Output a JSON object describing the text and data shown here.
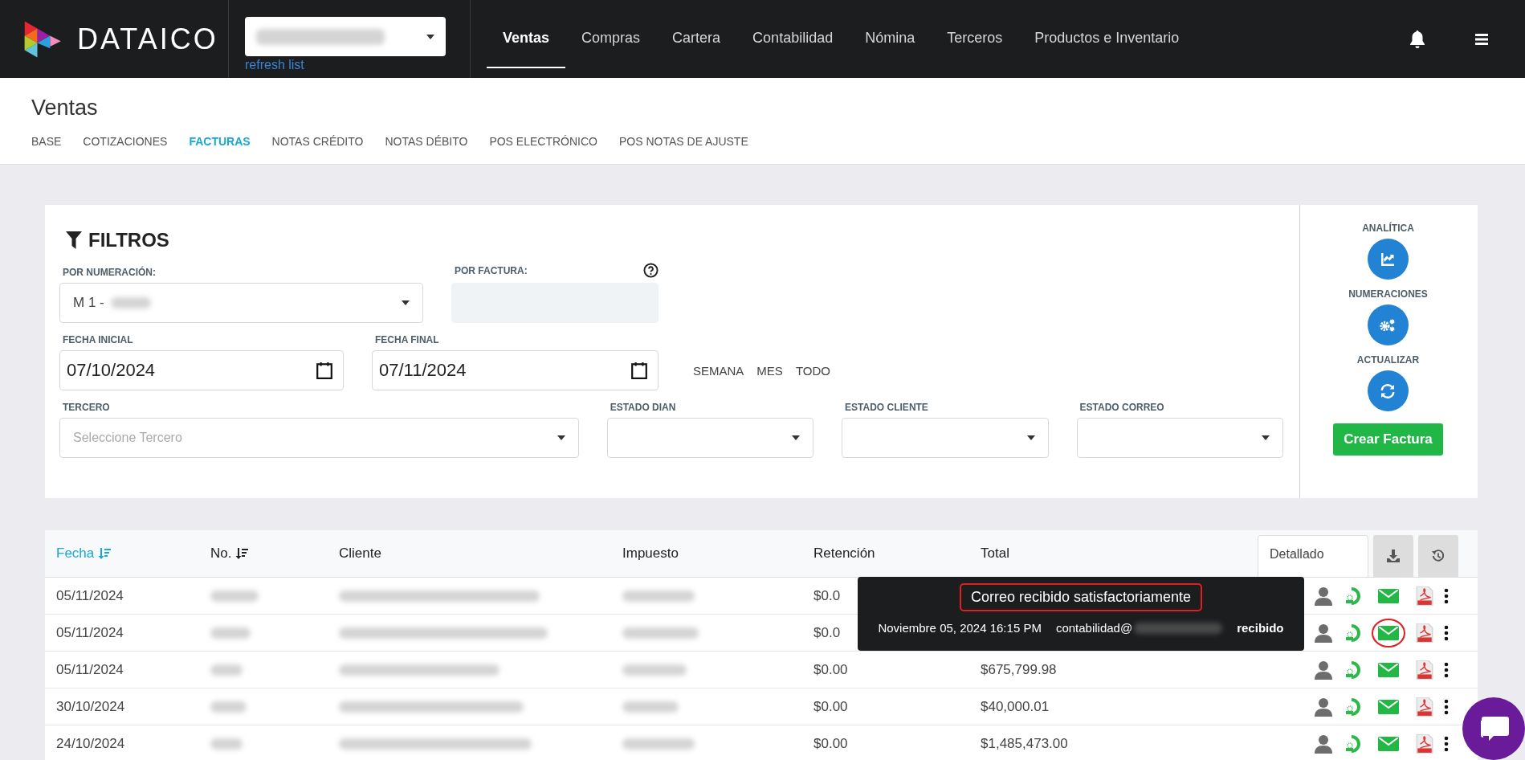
{
  "topbar": {
    "brand": "DATAICO",
    "refresh_link": "refresh list",
    "nav": [
      {
        "label": "Ventas",
        "selected": true
      },
      {
        "label": "Compras",
        "selected": false
      },
      {
        "label": "Cartera",
        "selected": false
      },
      {
        "label": "Contabilidad",
        "selected": false
      },
      {
        "label": "Nómina",
        "selected": false
      },
      {
        "label": "Terceros",
        "selected": false
      },
      {
        "label": "Productos e Inventario",
        "selected": false
      }
    ]
  },
  "page": {
    "title": "Ventas",
    "tabs": [
      {
        "label": "BASE",
        "selected": false
      },
      {
        "label": "COTIZACIONES",
        "selected": false
      },
      {
        "label": "FACTURAS",
        "selected": true
      },
      {
        "label": "NOTAS CRÉDITO",
        "selected": false
      },
      {
        "label": "NOTAS DÉBITO",
        "selected": false
      },
      {
        "label": "POS ELECTRÓNICO",
        "selected": false
      },
      {
        "label": "POS NOTAS DE AJUSTE",
        "selected": false
      }
    ]
  },
  "filters": {
    "title": "FILTROS",
    "numeracion": {
      "label": "POR NUMERACIÓN:",
      "value": "M 1 -"
    },
    "factura": {
      "label": "POR FACTURA:"
    },
    "fecha_inicial": {
      "label": "FECHA INICIAL",
      "value": "07/10/2024"
    },
    "fecha_final": {
      "label": "FECHA FINAL",
      "value": "07/11/2024"
    },
    "quick_ranges": [
      "SEMANA",
      "MES",
      "TODO"
    ],
    "tercero": {
      "label": "TERCERO",
      "placeholder": "Seleccione Tercero"
    },
    "estados": [
      {
        "label": "ESTADO DIAN"
      },
      {
        "label": "ESTADO CLIENTE"
      },
      {
        "label": "ESTADO CORREO"
      }
    ]
  },
  "actions": {
    "items": [
      {
        "label": "ANALÍTICA",
        "kind": "chart"
      },
      {
        "label": "NUMERACIONES",
        "kind": "gears"
      },
      {
        "label": "ACTUALIZAR",
        "kind": "refresh"
      }
    ],
    "create_button": "Crear Factura"
  },
  "table": {
    "columns": [
      {
        "label": "Fecha",
        "sortable": true,
        "selected": true
      },
      {
        "label": "No.",
        "sortable": true,
        "selected": false
      },
      {
        "label": "Cliente",
        "sortable": false,
        "selected": false
      },
      {
        "label": "Impuesto",
        "sortable": false,
        "selected": false
      },
      {
        "label": "Retención",
        "sortable": false,
        "selected": false
      },
      {
        "label": "Total",
        "sortable": false,
        "selected": false
      }
    ],
    "view_select": "Detallado",
    "rows": [
      {
        "fecha": "05/11/2024",
        "retencion": "$0.0",
        "highlighted": false
      },
      {
        "fecha": "05/11/2024",
        "retencion": "$0.0",
        "highlighted": true
      },
      {
        "fecha": "05/11/2024",
        "retencion": "$0.00",
        "total": "$675,799.98",
        "highlighted": false
      },
      {
        "fecha": "30/10/2024",
        "retencion": "$0.00",
        "total": "$40,000.01",
        "highlighted": false
      },
      {
        "fecha": "24/10/2024",
        "retencion": "$0.00",
        "total": "$1,485,473.00",
        "highlighted": false
      }
    ]
  },
  "tooltip": {
    "title": "Correo recibido satisfactoriamente",
    "title_highlighted": true,
    "date": "Noviembre 05, 2024 16:15 PM",
    "email": "contabilidad@",
    "status": "recibido"
  }
}
